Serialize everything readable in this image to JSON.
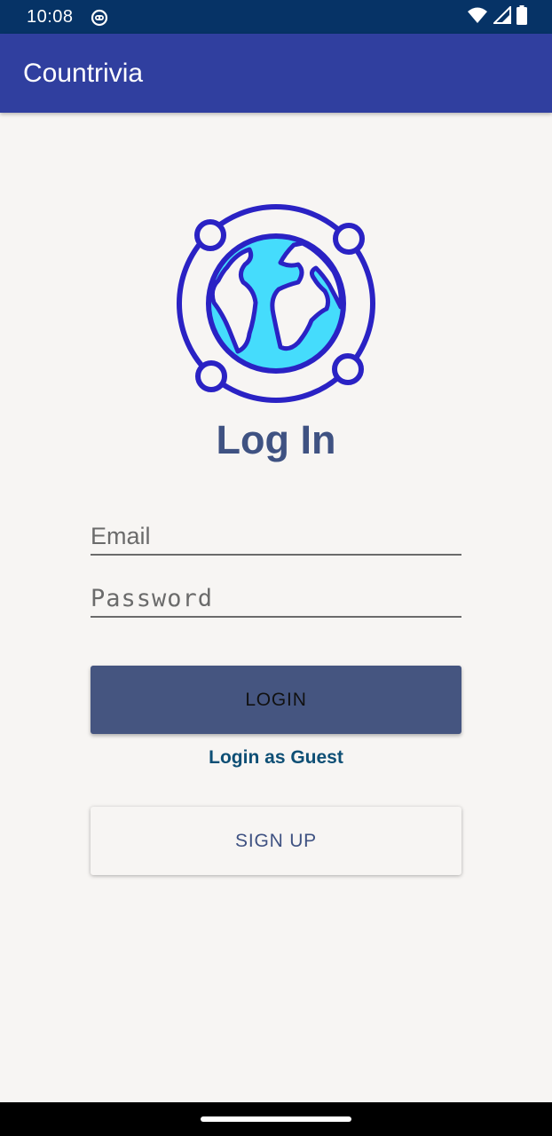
{
  "status_bar": {
    "time": "10:08",
    "icons": [
      "app-notification-icon",
      "wifi-icon",
      "signal-icon",
      "battery-icon"
    ]
  },
  "app_bar": {
    "title": "Countrivia"
  },
  "logo": {
    "icon": "globe-icon",
    "colors": {
      "stroke": "#2a22c4",
      "fill": "#45dcfc"
    }
  },
  "login": {
    "heading": "Log In",
    "email_placeholder": "Email",
    "password_placeholder": "Password",
    "login_button": "LOGIN",
    "guest_link": "Login as Guest",
    "signup_button": "SIGN UP"
  },
  "colors": {
    "status_bar": "#063366",
    "app_bar": "#303f9f",
    "primary_button": "#455580",
    "heading": "#3f5282",
    "link": "#0e4f75",
    "background": "#f7f5f3"
  }
}
